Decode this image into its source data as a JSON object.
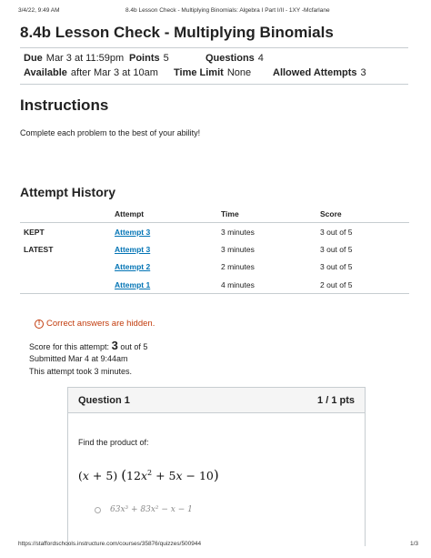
{
  "print_header": {
    "datetime": "3/4/22, 9:49 AM",
    "doc_title": "8.4b Lesson Check - Multiplying Binomials: Algebra I Part I/II - 1XY -Mcfarlane"
  },
  "quiz": {
    "title": "8.4b Lesson Check - Multiplying Binomials",
    "due_label": "Due",
    "due_value": "Mar 3 at 11:59pm",
    "points_label": "Points",
    "points_value": "5",
    "questions_label": "Questions",
    "questions_value": "4",
    "available_label": "Available",
    "available_value": "after Mar 3 at 10am",
    "time_limit_label": "Time Limit",
    "time_limit_value": "None",
    "attempts_label": "Allowed Attempts",
    "attempts_value": "3"
  },
  "instructions": {
    "heading": "Instructions",
    "text": "Complete each problem to the best of your ability!"
  },
  "attempt_history": {
    "heading": "Attempt History",
    "columns": [
      "",
      "Attempt",
      "Time",
      "Score"
    ],
    "rows": [
      {
        "tag": "KEPT",
        "attempt": "Attempt 3",
        "time": "3 minutes",
        "score": "3 out of 5"
      },
      {
        "tag": "LATEST",
        "attempt": "Attempt 3",
        "time": "3 minutes",
        "score": "3 out of 5"
      },
      {
        "tag": "",
        "attempt": "Attempt 2",
        "time": "2 minutes",
        "score": "3 out of 5"
      },
      {
        "tag": "",
        "attempt": "Attempt 1",
        "time": "4 minutes",
        "score": "2 out of 5"
      }
    ]
  },
  "results": {
    "hidden_notice": "Correct answers are hidden.",
    "score_prefix": "Score for this attempt:",
    "score_value": "3",
    "score_suffix": "out of 5",
    "submitted": "Submitted Mar 4 at 9:44am",
    "duration": "This attempt took 3 minutes."
  },
  "question1": {
    "title": "Question 1",
    "points": "1 / 1 pts",
    "prompt": "Find the product of:",
    "answer_option": "63x³ + 83x² − x − 1"
  },
  "print_footer": {
    "url": "https://staffordschools.instructure.com/courses/35876/quizzes/500944",
    "page": "1/3"
  },
  "colors": {
    "link": "#0374b5",
    "warning": "#c23c0d",
    "rule": "#c7cdd1"
  }
}
